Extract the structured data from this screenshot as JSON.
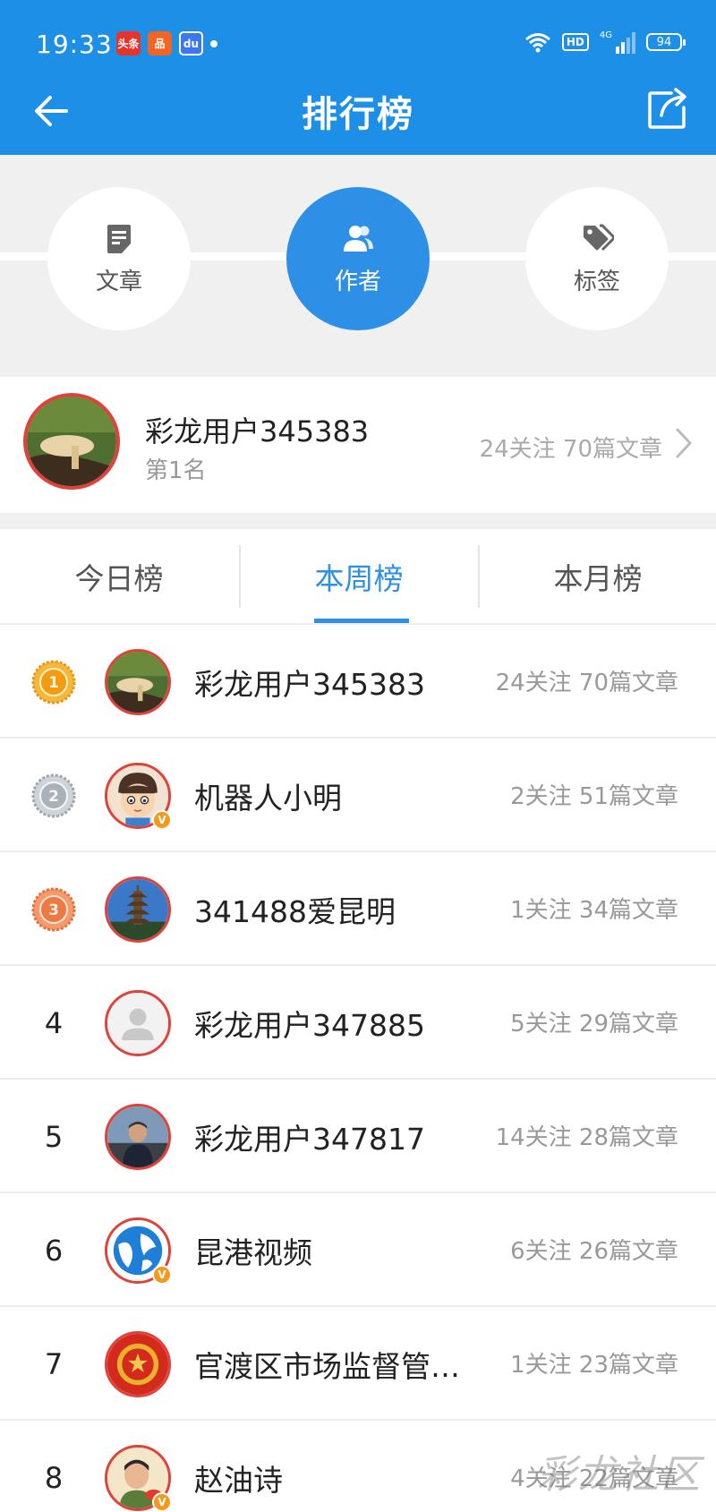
{
  "status_bar": {
    "time": "19:33",
    "app_badges": [
      {
        "name": "toutiao-app-icon",
        "text": "头条"
      },
      {
        "name": "xiaohongshu-app-icon",
        "text": "品"
      },
      {
        "name": "baidu-app-icon",
        "text": "du"
      }
    ],
    "hd": "HD",
    "network": "4G",
    "battery": "94"
  },
  "header": {
    "title": "排行榜"
  },
  "categories": [
    {
      "label": "文章",
      "icon": "document-icon",
      "active": false
    },
    {
      "label": "作者",
      "icon": "users-icon",
      "active": true
    },
    {
      "label": "标签",
      "icon": "tag-icon",
      "active": false
    }
  ],
  "top_author": {
    "name": "彩龙用户345383",
    "rank_text": "第1名",
    "stats": "24关注 70篇文章"
  },
  "period_tabs": [
    {
      "label": "今日榜",
      "active": false
    },
    {
      "label": "本周榜",
      "active": true
    },
    {
      "label": "本月榜",
      "active": false
    }
  ],
  "ranking": [
    {
      "rank": "1",
      "medal": "gold",
      "name": "彩龙用户345383",
      "stats": "24关注 70篇文章",
      "verified": false
    },
    {
      "rank": "2",
      "medal": "silver",
      "name": "机器人小明",
      "stats": "2关注 51篇文章",
      "verified": true
    },
    {
      "rank": "3",
      "medal": "bronze",
      "name": "341488爱昆明",
      "stats": "1关注 34篇文章",
      "verified": false
    },
    {
      "rank": "4",
      "medal": "",
      "name": "彩龙用户347885",
      "stats": "5关注 29篇文章",
      "verified": false
    },
    {
      "rank": "5",
      "medal": "",
      "name": "彩龙用户347817",
      "stats": "14关注 28篇文章",
      "verified": false
    },
    {
      "rank": "6",
      "medal": "",
      "name": "昆港视频",
      "stats": "6关注 26篇文章",
      "verified": true
    },
    {
      "rank": "7",
      "medal": "",
      "name": "官渡区市场监督管…",
      "stats": "1关注 23篇文章",
      "verified": false
    },
    {
      "rank": "8",
      "medal": "",
      "name": "赵油诗",
      "stats": "4关注 22篇文章",
      "verified": true
    }
  ],
  "watermark": "彩龙社区",
  "colors": {
    "primary": "#1e8fe6",
    "accent": "#2d8fe6",
    "avatar_border": "#e0413a",
    "background_gray": "#f0f0f0"
  }
}
